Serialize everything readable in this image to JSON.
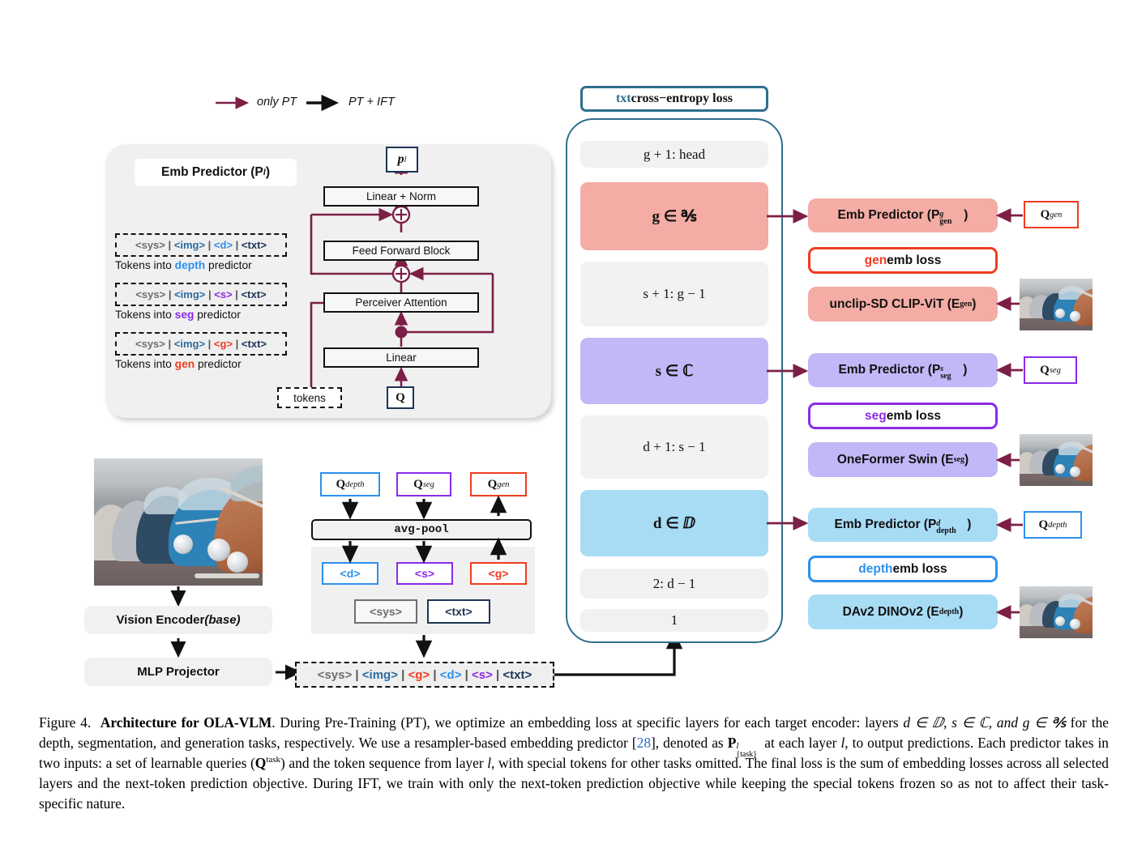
{
  "legend": {
    "only_pt": "only PT",
    "pt_ift": "PT + IFT",
    "only_pt_color": "#7c1f46",
    "pt_ift_color": "#111111"
  },
  "emb_predictor": {
    "title": "Emb Predictor (P",
    "title_sup": "l",
    "title_close": ")",
    "output_label": "p",
    "output_sup": "l",
    "blocks": [
      "Linear + Norm",
      "Feed Forward Block",
      "Perceiver Attention",
      "Linear"
    ],
    "query_input": "Q",
    "tokens_input": "tokens",
    "token_rows": [
      {
        "seq": [
          "<sys>",
          "<img>",
          "<d>",
          "<txt>"
        ],
        "caption_pre": "Tokens into ",
        "caption_task": "depth",
        "caption_post": " predictor",
        "task_color": "#2e90ef"
      },
      {
        "seq": [
          "<sys>",
          "<img>",
          "<s>",
          "<txt>"
        ],
        "caption_pre": "Tokens into ",
        "caption_task": "seg",
        "caption_post": " predictor",
        "task_color": "#8b2be8"
      },
      {
        "seq": [
          "<sys>",
          "<img>",
          "<g>",
          "<txt>"
        ],
        "caption_pre": "Tokens into ",
        "caption_task": "gen",
        "caption_post": " predictor",
        "task_color": "#f03c20"
      }
    ]
  },
  "pipeline": {
    "vision_encoder": "Vision Encoder ",
    "vision_encoder_em": "(base)",
    "mlp_projector": "MLP Projector",
    "avg_pool": "avg-pool",
    "queries": [
      {
        "label": "Q",
        "sup": "depth",
        "color": "#2e90ef"
      },
      {
        "label": "Q",
        "sup": "seg",
        "color": "#8b2be8"
      },
      {
        "label": "Q",
        "sup": "gen",
        "color": "#f03c20"
      }
    ],
    "special_tokens": [
      {
        "label": "<d>",
        "color": "#2e90ef"
      },
      {
        "label": "<s>",
        "color": "#8b2be8"
      },
      {
        "label": "<g>",
        "color": "#f03c20"
      }
    ],
    "sys_token": "<sys>",
    "txt_token": "<txt>",
    "final_sequence": [
      "<sys>",
      "<img>",
      "<g>",
      "<d>",
      "<s>",
      "<txt>"
    ]
  },
  "llm_stack": {
    "ce_loss_prefix": "txt",
    "ce_loss_rest": " cross−entropy loss",
    "border_color": "#2e6e8e",
    "layers": [
      {
        "name": "g + 1: head",
        "type": "plain",
        "color": "#f1f1f1",
        "tall": false
      },
      {
        "name": "g ∈ ℁",
        "type": "target",
        "color": "#f4aca5",
        "tall": true,
        "task": "gen"
      },
      {
        "name": "s + 1: g − 1",
        "type": "plain",
        "color": "#f2f2f2",
        "tall": true
      },
      {
        "name": "s ∈ ℂ",
        "type": "target",
        "color": "#c2b8f7",
        "tall": true,
        "task": "seg"
      },
      {
        "name": "d + 1: s − 1",
        "type": "plain",
        "color": "#f2f2f2",
        "tall": true
      },
      {
        "name": "d ∈ ⅅ",
        "type": "target",
        "color": "#a8dcf5",
        "tall": true,
        "task": "depth"
      },
      {
        "name": "2: d − 1",
        "type": "plain",
        "color": "#f1f1f1",
        "tall": false
      },
      {
        "name": "1",
        "type": "plain",
        "color": "#f1f1f1",
        "tall": false
      }
    ]
  },
  "branches": [
    {
      "task": "gen",
      "accent": "#f03c20",
      "fill": "#f4aca5",
      "predictor_pre": "Emb Predictor (P",
      "predictor_sup": "g",
      "predictor_sub": "gen",
      "predictor_post": ")",
      "query": "Q",
      "query_sup": "gen",
      "loss_task": "gen",
      "loss_rest": " emb loss",
      "encoder_pre": "unclip-SD CLIP-ViT (E",
      "encoder_sup": "gen",
      "encoder_post": ")"
    },
    {
      "task": "seg",
      "accent": "#8b2be8",
      "fill": "#c2b8f7",
      "predictor_pre": "Emb Predictor (P",
      "predictor_sup": "s",
      "predictor_sub": "seg",
      "predictor_post": ")",
      "query": "Q",
      "query_sup": "seg",
      "loss_task": "seg",
      "loss_rest": " emb loss",
      "encoder_pre": "OneFormer Swin (E",
      "encoder_sup": "seg",
      "encoder_post": ")"
    },
    {
      "task": "depth",
      "accent": "#2e90ef",
      "fill": "#a8dcf5",
      "predictor_pre": "Emb Predictor (P",
      "predictor_sup": "d",
      "predictor_sub": "depth",
      "predictor_post": ")",
      "query": "Q",
      "query_sup": "depth",
      "loss_task": "depth",
      "loss_rest": " emb loss",
      "encoder_pre": "DAv2 DINOv2 (E",
      "encoder_sup": "depth",
      "encoder_post": ")"
    }
  ],
  "caption": {
    "fig_no": "Figure 4.",
    "title": "Architecture for OLA-VLM",
    "part1": ". During Pre-Training (PT), we optimize an embedding loss at specific layers for each target encoder: layers ",
    "math1": "d ∈ ⅅ, s ∈ ℂ, and g ∈ ℁",
    "part2": " for the depth, segmentation, and generation tasks, respectively. We use a resampler-based embedding predictor [",
    "ref": "28",
    "part3": "], denoted as ",
    "math2": "P",
    "math2_sup": "l",
    "math2_sub": "{task}",
    "part4": " at each layer ",
    "math3": "l",
    "part5": ", to output predictions. Each predictor takes in two inputs: a set of learnable queries (",
    "math4": "Q",
    "math4_sup": "task",
    "part6": ") and the token sequence from layer ",
    "math5": "l",
    "part7": ", with special tokens for other tasks omitted. The final loss is the sum of embedding losses across all selected layers and the next-token prediction objective. During IFT, we train with only the next-token prediction objective while keeping the special tokens frozen so as not to affect their task-specific nature."
  }
}
